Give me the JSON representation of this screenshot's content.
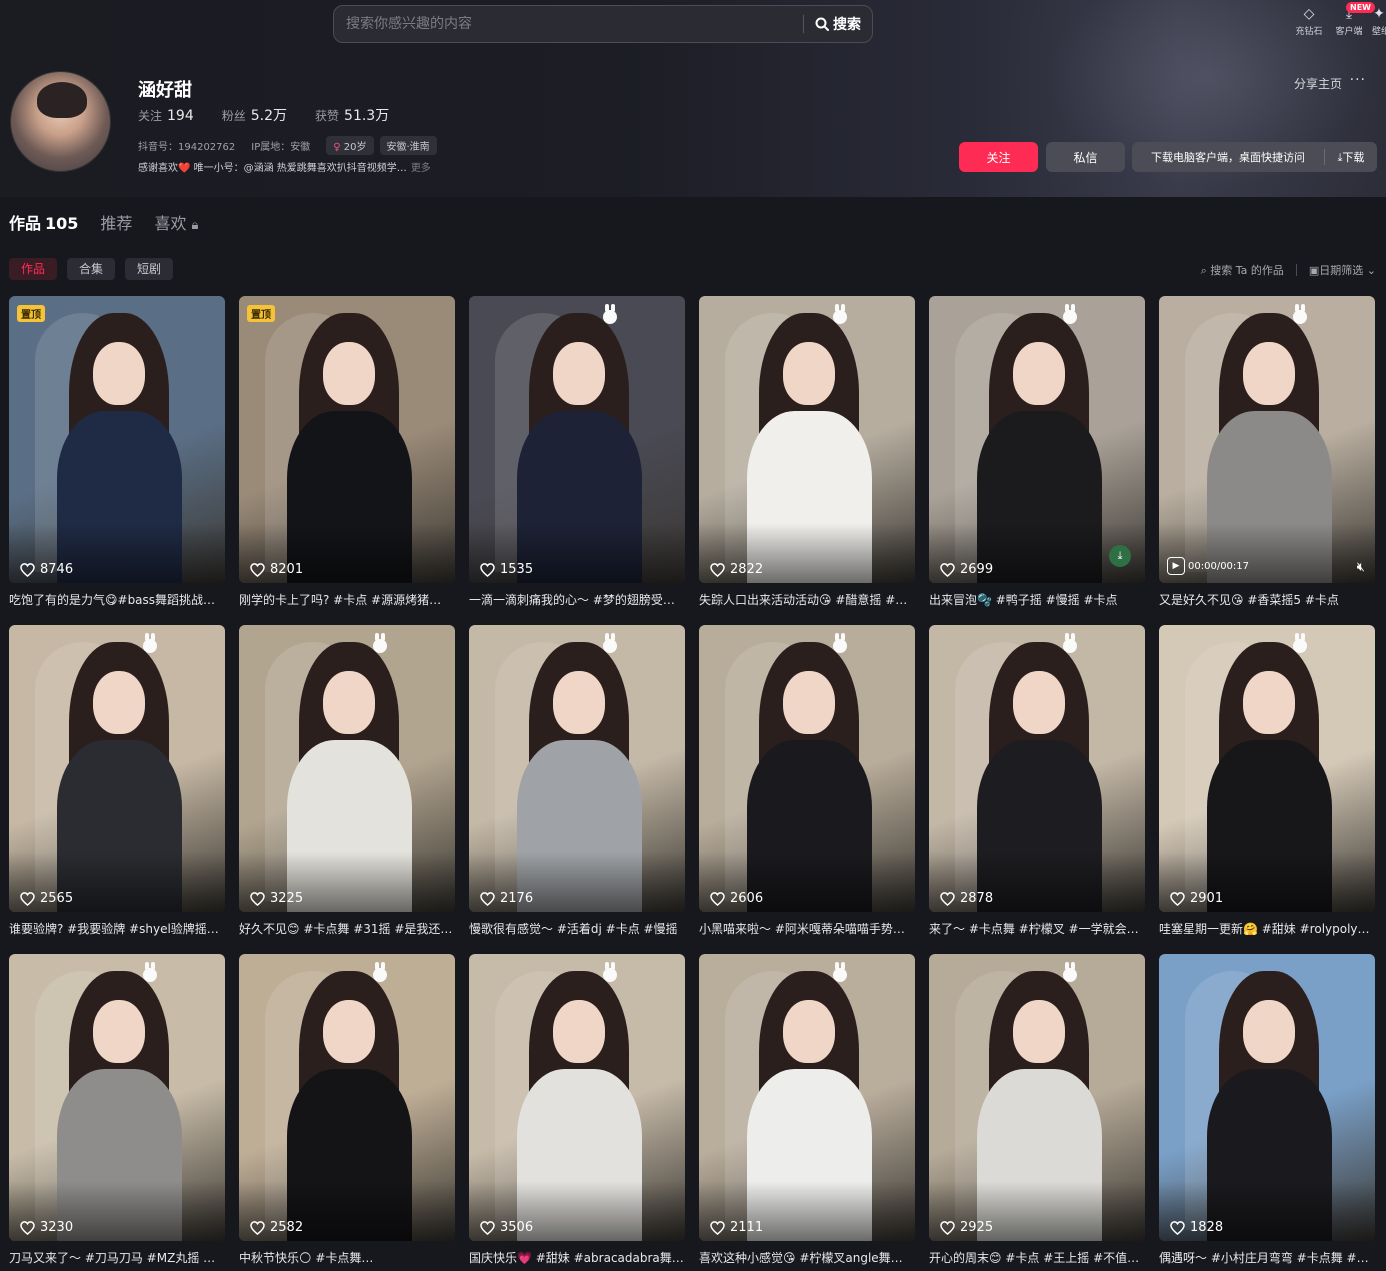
{
  "search": {
    "placeholder": "搜索你感兴趣的内容",
    "button": "搜索"
  },
  "top_actions": [
    {
      "label": "充钻石",
      "icon": "diamond-icon"
    },
    {
      "label": "客户端",
      "icon": "download-icon",
      "badge": "NEW"
    },
    {
      "label": "壁纸",
      "icon": "wallpaper-icon"
    }
  ],
  "profile": {
    "nickname": "涵好甜",
    "following_label": "关注",
    "following": "194",
    "followers_label": "粉丝",
    "followers": "5.2万",
    "likes_label": "获赞",
    "likes": "51.3万",
    "douyin_id": "抖音号：194202762",
    "ip": "IP属地：安徽",
    "age": "20岁",
    "location": "安徽·淮南",
    "bio": "感谢喜欢❤️ 唯一小号：@涵涵 热爱跳舞喜欢扒抖音视频学…",
    "bio_more": "更多"
  },
  "actions": {
    "share": "分享主页",
    "follow": "关注",
    "message": "私信",
    "desktop_shortcut": "下载电脑客户端，桌面快捷访问",
    "download": "⤓下载"
  },
  "tabs": [
    {
      "label": "作品",
      "count": "105",
      "active": true
    },
    {
      "label": "推荐",
      "count": "",
      "active": false
    },
    {
      "label": "喜欢",
      "count": "",
      "active": false,
      "locked": true
    }
  ],
  "subtabs": [
    {
      "label": "作品",
      "active": true
    },
    {
      "label": "合集",
      "active": false
    },
    {
      "label": "短剧",
      "active": false
    }
  ],
  "filters": {
    "search_works": "搜索 Ta 的作品",
    "date_filter": "日期筛选"
  },
  "videos": [
    {
      "likes": "8746",
      "caption": "吃饱了有的是力气😋#bass舞蹈挑战…",
      "pinned": "置顶",
      "colors": [
        "#5a6f86",
        "#1f2a44"
      ]
    },
    {
      "likes": "8201",
      "caption": "刚学的卡上了吗? #卡点 #源源烤猪…",
      "pinned": "置顶",
      "colors": [
        "#9a8a78",
        "#131418"
      ]
    },
    {
      "likes": "1535",
      "caption": "一滴一滴刺痛我的心～ #梦的翅膀受…",
      "colors": [
        "#4a4a55",
        "#1d2236"
      ]
    },
    {
      "likes": "2822",
      "caption": "失踪人口出来活动活动😘 #醋意摇 #…",
      "colors": [
        "#b6ad9f",
        "#f0efec"
      ]
    },
    {
      "likes": "2699",
      "caption": "出来冒泡🫧 #鸭子摇 #慢摇 #卡点",
      "colors": [
        "#aaa298",
        "#1b1b1e"
      ],
      "download": true
    },
    {
      "likes": "",
      "caption": "又是好久不见😘 #香菜摇5 #卡点",
      "colors": [
        "#b9ae9f",
        "#8c8a88"
      ],
      "player": "00:00/00:17"
    },
    {
      "likes": "2565",
      "caption": "谁要验牌? #我要验牌 #shyel验牌摇…",
      "colors": [
        "#c6b8a4",
        "#2a2c31"
      ]
    },
    {
      "likes": "3225",
      "caption": "好久不见😊 #卡点舞 #31摇 #是我还…",
      "colors": [
        "#b2a590",
        "#e4e2dc"
      ]
    },
    {
      "likes": "2176",
      "caption": "慢歌很有感觉～ #活着dj #卡点 #慢摇",
      "colors": [
        "#c4b8a6",
        "#9fa2a6"
      ]
    },
    {
      "likes": "2606",
      "caption": "小黑喵来啦～ #阿米嘎蒂朵喵喵手势…",
      "colors": [
        "#b8ac9a",
        "#1a1a1e"
      ]
    },
    {
      "likes": "2878",
      "caption": "来了～ #卡点舞 #柠檬叉 #一学就会…",
      "colors": [
        "#c3b7a6",
        "#1d1d21"
      ]
    },
    {
      "likes": "2901",
      "caption": "哇塞星期一更新🤗 #甜妹 #rolypoly…",
      "colors": [
        "#d4c8b6",
        "#17171a"
      ]
    },
    {
      "likes": "3230",
      "caption": "刀马又来了～ #刀马刀马 #MZ丸摇 #…",
      "colors": [
        "#c8bca8",
        "#8f8d8b"
      ]
    },
    {
      "likes": "2582",
      "caption": "中秋节快乐🌕 #卡点舞…",
      "colors": [
        "#bfae96",
        "#141417"
      ]
    },
    {
      "likes": "3506",
      "caption": "国庆快乐💗 #甜妹 #abracadabra舞…",
      "colors": [
        "#c6baa8",
        "#e3e1dd"
      ]
    },
    {
      "likes": "2111",
      "caption": "喜欢这种小感觉😘 #柠檬叉angle舞…",
      "colors": [
        "#b9ad9c",
        "#ededeb"
      ]
    },
    {
      "likes": "2925",
      "caption": "开心的周末😊 #卡点 #王上摇 #不值…",
      "colors": [
        "#b6aa98",
        "#dcdad6"
      ]
    },
    {
      "likes": "1828",
      "caption": "偶遇呀～ #小村庄月弯弯 #卡点舞 #…",
      "colors": [
        "#7aa0c8",
        "#1a1a1e"
      ]
    }
  ]
}
